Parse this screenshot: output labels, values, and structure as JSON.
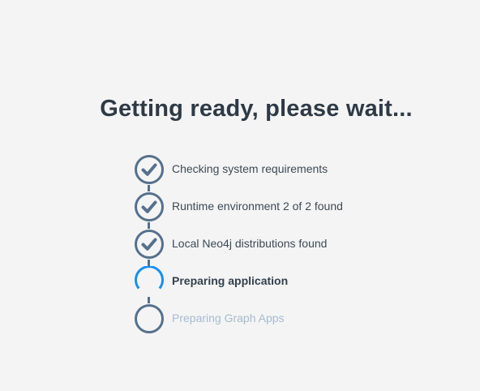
{
  "title": "Getting ready, please wait...",
  "steps": [
    {
      "label": "Checking system requirements",
      "status": "done"
    },
    {
      "label": "Runtime environment 2 of 2 found",
      "status": "done"
    },
    {
      "label": "Local Neo4j distributions found",
      "status": "done"
    },
    {
      "label": "Preparing application",
      "status": "active"
    },
    {
      "label": "Preparing Graph Apps",
      "status": "pending"
    }
  ],
  "icons": {
    "done": "check-circle-icon",
    "active": "spinner-icon",
    "pending": "empty-circle-icon"
  },
  "colors": {
    "background": "#f4f4f4",
    "title": "#2e3a46",
    "step_circle": "#56708c",
    "spinner": "#1a8ff0",
    "pending_text": "#a6bbd0"
  }
}
